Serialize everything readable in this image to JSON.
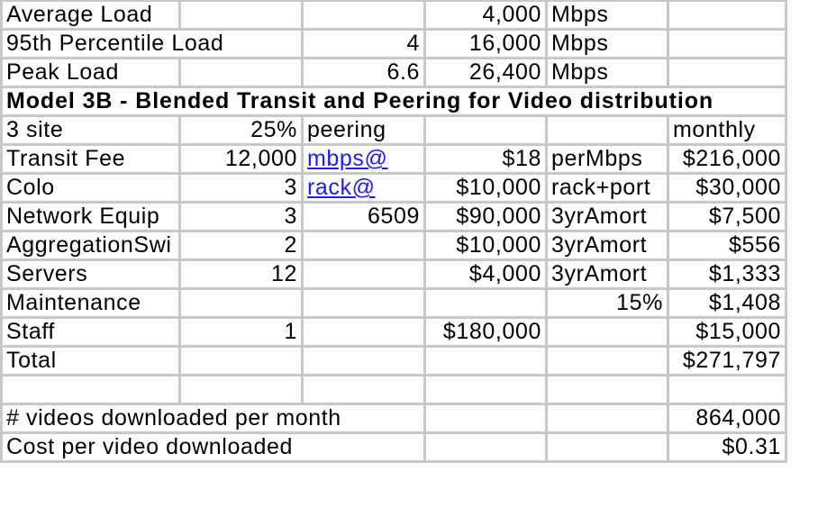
{
  "load_rows": [
    {
      "label": "Average Load",
      "multiplier": "",
      "value": "4,000",
      "unit": "Mbps"
    },
    {
      "label": "95th Percentile Load",
      "multiplier": "4",
      "value": "16,000",
      "unit": "Mbps"
    },
    {
      "label": "Peak Load",
      "multiplier": "6.6",
      "value": "26,400",
      "unit": "Mbps"
    }
  ],
  "model_title": "Model 3B - Blended Transit and Peering for Video distribution",
  "site_row": {
    "label": "3 site",
    "percent": "25%",
    "peering": "peering",
    "monthly_header": "monthly"
  },
  "cost_rows": [
    {
      "label": "Transit Fee",
      "qty": "12,000",
      "note": "mbps@",
      "note_link": true,
      "unit_cost": "$18",
      "basis": "perMbps",
      "monthly": "$216,000"
    },
    {
      "label": "Colo",
      "qty": "3",
      "note": "rack@",
      "note_link": true,
      "unit_cost": "$10,000",
      "basis": "rack+port",
      "monthly": "$30,000"
    },
    {
      "label": "Network Equip",
      "qty": "3",
      "note": "6509",
      "note_link": false,
      "unit_cost": "$90,000",
      "basis": "3yrAmort",
      "monthly": "$7,500"
    },
    {
      "label": "AggregationSwi",
      "qty": "2",
      "note": "",
      "note_link": false,
      "unit_cost": "$10,000",
      "basis": "3yrAmort",
      "monthly": "$556"
    },
    {
      "label": "Servers",
      "qty": "12",
      "note": "",
      "note_link": false,
      "unit_cost": "$4,000",
      "basis": "3yrAmort",
      "monthly": "$1,333"
    },
    {
      "label": "Maintenance",
      "qty": "",
      "note": "",
      "note_link": false,
      "unit_cost": "",
      "basis": "15%",
      "monthly": "$1,408"
    },
    {
      "label": "Staff",
      "qty": "1",
      "note": "",
      "note_link": false,
      "unit_cost": "$180,000",
      "basis": "",
      "monthly": "$15,000"
    }
  ],
  "total": {
    "label": "Total",
    "monthly": "$271,797"
  },
  "videos": {
    "label": "# videos downloaded per month",
    "value": "864,000"
  },
  "cost_per_video": {
    "label": "Cost per video downloaded",
    "value": "$0.31"
  },
  "colors": {
    "link": "#1a1aff",
    "grid": "#c8c8c8",
    "rule": "#000000"
  }
}
